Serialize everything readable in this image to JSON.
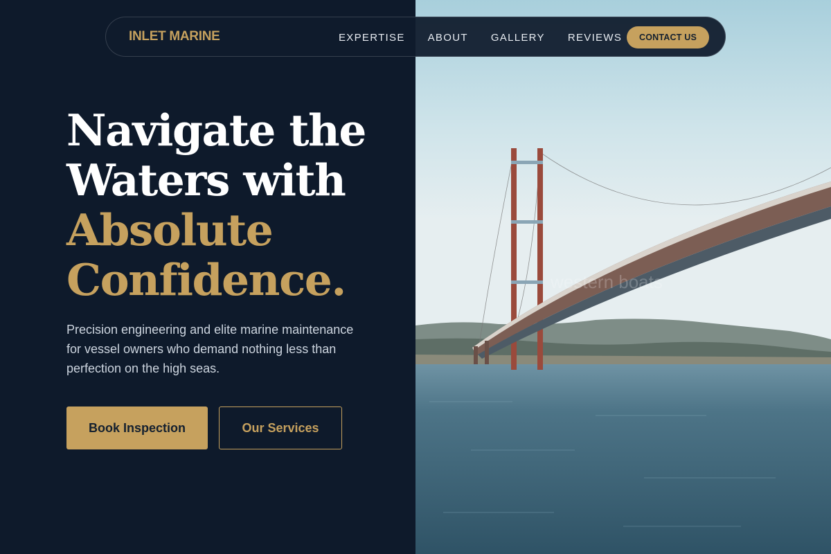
{
  "nav": {
    "brand": "INLET MARINE",
    "links": [
      "EXPERTISE",
      "ABOUT",
      "GALLERY",
      "REVIEWS"
    ],
    "cta": "CONTACT US"
  },
  "hero": {
    "title_line1": "Navigate the",
    "title_line2": "Waters with",
    "title_line3": "Absolute",
    "title_line4": "Confidence.",
    "subtitle": "Precision engineering and elite marine maintenance for vessel owners who demand nothing less than perfection on the high seas.",
    "primary_button": "Book Inspection",
    "secondary_button": "Our Services"
  },
  "image": {
    "watermark": "western boats"
  },
  "colors": {
    "background": "#0e1a2b",
    "accent": "#c6a15e",
    "text": "#ffffff"
  }
}
